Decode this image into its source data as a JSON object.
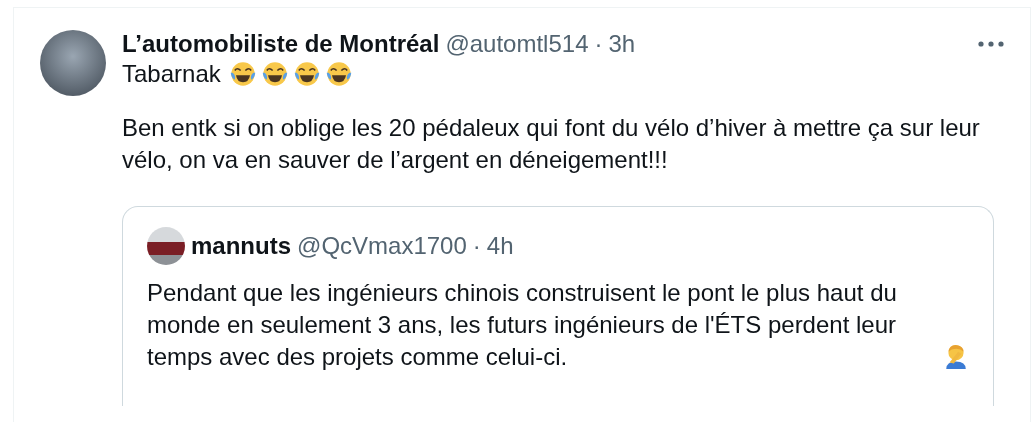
{
  "tweet": {
    "author": {
      "name": "L’automobiliste de Montréal",
      "handle": "@automtl514",
      "separator": "·",
      "time": "3h"
    },
    "first_line": {
      "text": "Tabarnak",
      "emoji": [
        {
          "kind": "tears-of-joy"
        },
        {
          "kind": "tears-of-joy"
        },
        {
          "kind": "tears-of-joy"
        },
        {
          "kind": "tears-of-joy"
        }
      ]
    },
    "body": "Ben entk si on oblige les 20 pédaleux qui font du vélo d’hiver à mettre ça sur leur vélo, on va en sauver de l’argent en déneigement!!!",
    "quoted": {
      "author": {
        "name": "mannuts",
        "handle": "@QcVmax1700",
        "separator": "·",
        "time": "4h"
      },
      "text": "Pendant que les ingénieurs chinois construisent le pont le plus haut du monde en seulement 3 ans, les futurs ingénieurs de l'ÉTS perdent leur temps avec des projets comme celui-ci.",
      "emoji": [
        {
          "kind": "facepalm"
        }
      ]
    }
  }
}
